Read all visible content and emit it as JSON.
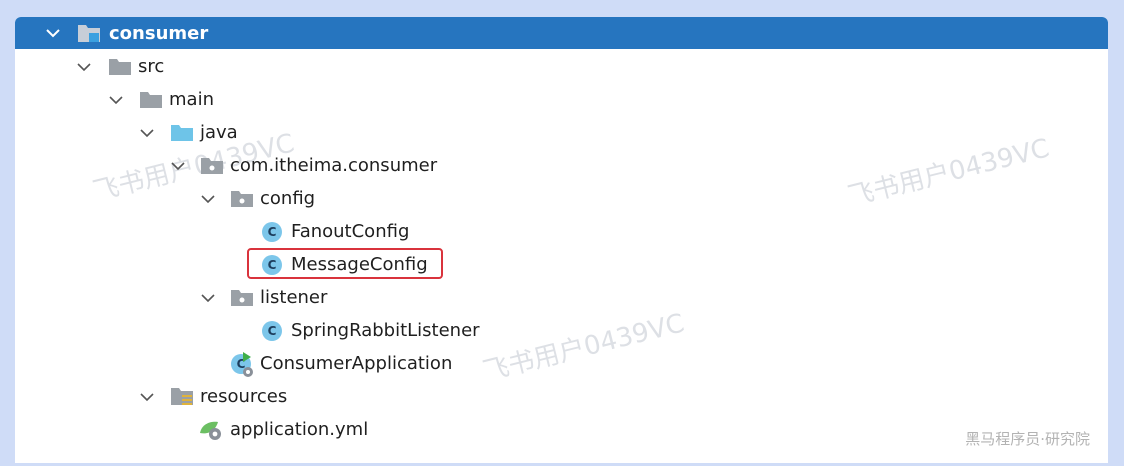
{
  "tree": {
    "root": {
      "label": "consumer",
      "expanded": true,
      "icon": "module-folder-icon"
    },
    "items": [
      {
        "label": "src",
        "icon": "folder-icon",
        "expanded": true
      },
      {
        "label": "main",
        "icon": "folder-icon",
        "expanded": true
      },
      {
        "label": "java",
        "icon": "source-folder-icon",
        "expanded": true
      },
      {
        "label": "com.itheima.consumer",
        "icon": "package-icon",
        "expanded": true
      },
      {
        "label": "config",
        "icon": "package-icon",
        "expanded": true
      },
      {
        "label": "FanoutConfig",
        "icon": "class-icon",
        "badge": "C"
      },
      {
        "label": "MessageConfig",
        "icon": "class-icon",
        "badge": "C",
        "highlighted": true
      },
      {
        "label": "listener",
        "icon": "package-icon",
        "expanded": true
      },
      {
        "label": "SpringRabbitListener",
        "icon": "class-icon",
        "badge": "C"
      },
      {
        "label": "ConsumerApplication",
        "icon": "spring-boot-class-icon",
        "badge": "C"
      },
      {
        "label": "resources",
        "icon": "resources-folder-icon",
        "expanded": true
      },
      {
        "label": "application.yml",
        "icon": "yaml-config-icon"
      }
    ]
  },
  "watermarks": {
    "user": "飞书用户0439VC",
    "footer": "黑马程序员·研究院"
  },
  "colors": {
    "selection": "#2675bf",
    "highlight_border": "#d9333c",
    "class_badge": "#7cc6ea",
    "folder": "#9aa0a6",
    "source_folder": "#6ec4e8"
  }
}
